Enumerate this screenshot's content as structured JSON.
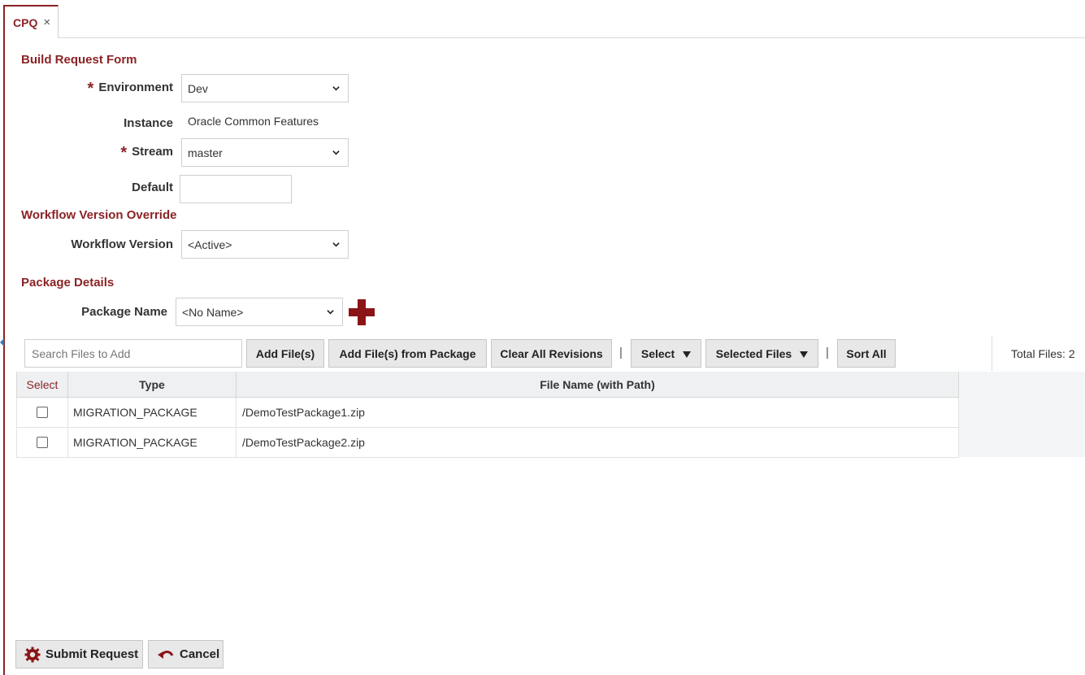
{
  "tab": {
    "label": "CPQ",
    "close": "×"
  },
  "sections": {
    "build": "Build Request Form",
    "workflow": "Workflow Version Override",
    "package": "Package Details"
  },
  "form": {
    "required_mark": "*",
    "environment": {
      "label": "Environment",
      "value": "Dev"
    },
    "instance": {
      "label": "Instance",
      "value": "Oracle Common Features"
    },
    "stream": {
      "label": "Stream",
      "value": "master"
    },
    "default": {
      "label": "Default",
      "value": ""
    },
    "workflow_version": {
      "label": "Workflow Version",
      "value": "<Active>"
    },
    "package_name": {
      "label": "Package Name",
      "value": "<No Name>"
    }
  },
  "toolbar": {
    "search_placeholder": "Search Files to Add",
    "add_files": "Add File(s)",
    "add_from_package": "Add File(s) from Package",
    "clear_revisions": "Clear All Revisions",
    "select": "Select",
    "selected_files": "Selected Files",
    "sort_all": "Sort All",
    "pipe": "|",
    "total_files_label": "Total Files:",
    "total_files_count": "2"
  },
  "grid": {
    "headers": [
      "Select",
      "Type",
      "File Name (with Path)"
    ],
    "rows": [
      {
        "type": "MIGRATION_PACKAGE",
        "file": "/DemoTestPackage1.zip",
        "checked": false
      },
      {
        "type": "MIGRATION_PACKAGE",
        "file": "/DemoTestPackage2.zip",
        "checked": false
      }
    ]
  },
  "footer": {
    "submit": "Submit Request",
    "cancel": "Cancel"
  },
  "colors": {
    "brand": "#8b2326",
    "button_bg": "#e8e8e8",
    "header_bg": "#eef0f2"
  },
  "icons": {
    "close": "close-icon",
    "chevron": "chevron-down-icon",
    "add_package": "plus-icon",
    "caret": "caret-down-icon",
    "submit": "gear-icon",
    "cancel": "undo-icon"
  }
}
